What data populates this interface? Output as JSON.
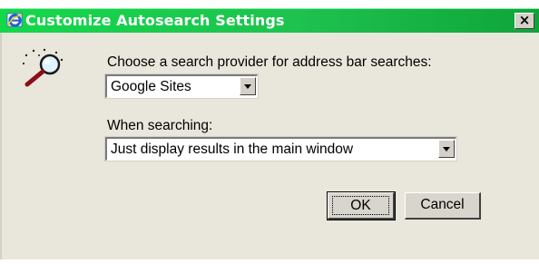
{
  "window": {
    "title": "Customize Autosearch Settings",
    "close_label": "×"
  },
  "provider": {
    "label": "Choose a search provider for address bar searches:",
    "selected": "Google Sites"
  },
  "searching": {
    "label": "When searching:",
    "selected": "Just display results in the main window"
  },
  "buttons": {
    "ok": "OK",
    "cancel": "Cancel"
  },
  "icons": {
    "title": "internet-explorer-icon",
    "main": "magnifying-glass-sparkle-icon"
  },
  "colors": {
    "titlebar": "#14d84a",
    "dialog_face": "#e9e6dc"
  }
}
